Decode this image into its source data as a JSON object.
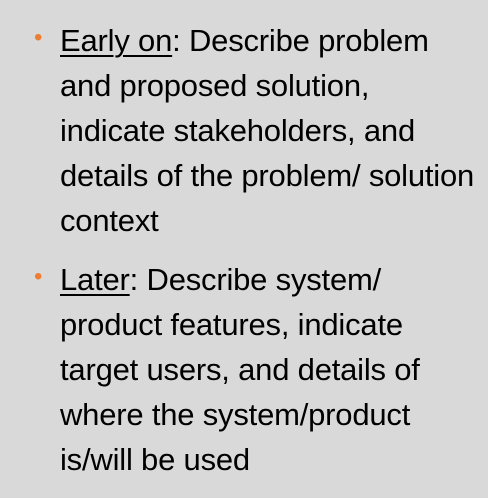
{
  "colors": {
    "background": "#d9d9d9",
    "bullet": "#ed7d31",
    "text": "#000000"
  },
  "bullets": [
    {
      "marker": "•",
      "term": "Early on",
      "separator": ":",
      "text": " Describe problem and proposed solution, indicate stakeholders, and details of the problem/ solution context"
    },
    {
      "marker": "•",
      "term": "Later",
      "separator": ":",
      "text": " Describe system/ product features, indicate target users, and details of where the system/product is/will be used"
    }
  ]
}
